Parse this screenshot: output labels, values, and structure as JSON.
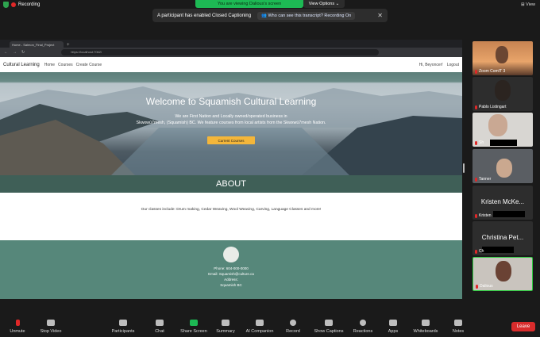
{
  "zoom_top": {
    "recording_label": "Recording",
    "viewing_label": "You are viewing Dalious's screen",
    "view_options_label": "View Options",
    "view_label": "View"
  },
  "caption_notice": {
    "message": "A participant has enabled Closed Captioning",
    "link": "Who can see this transcript? Recording On"
  },
  "browser": {
    "tab_title": "Home - Salmon_Final_Project",
    "url": "https://localhost:7062/"
  },
  "site": {
    "brand": "Cultural Learning",
    "nav": [
      "Home",
      "Courses",
      "Create Course"
    ],
    "greeting": "Hi, Beyoncer!",
    "logout": "Logout",
    "hero_title": "Welcome to Squamish Cultural Learning",
    "hero_line1": "We are First Nation and Locally owned/operated business in",
    "hero_line2": "Skwxwú7mesh, (Squamish) BC. We feature courses from local artists from the Skwxwú7mesh Nation.",
    "hero_button": "Current Courses",
    "about_heading": "ABOUT",
    "about_text": "Our classes include: Drum making, Cedar Weaving, Wool Weaving, Carving, Language Classes and more!",
    "footer_phone": "Phone: 604-000-0000",
    "footer_email": "Email: Squamish@culture.ca",
    "footer_address_label": "Address:",
    "footer_address": "Squamish BC"
  },
  "participants": [
    {
      "name": "Zoom ComIT 3",
      "muted": true
    },
    {
      "name": "Pablo Listingart",
      "muted": true
    },
    {
      "name": "Sh",
      "muted": true
    },
    {
      "name": "Tanner",
      "muted": true
    },
    {
      "name": "Kristen",
      "display": "Kristen McKe...",
      "muted": true
    },
    {
      "name": "Ch",
      "display": "Christina Pet...",
      "muted": true
    },
    {
      "name": "Dalious",
      "muted": true
    }
  ],
  "toolbar": {
    "unmute": "Unmute",
    "stop_video": "Stop Video",
    "participants": "Participants",
    "chat": "Chat",
    "share_screen": "Share Screen",
    "summary": "Summary",
    "ai_companion": "AI Companion",
    "record": "Record",
    "show_captions": "Show Captions",
    "reactions": "Reactions",
    "apps": "Apps",
    "whiteboards": "Whiteboards",
    "notes": "Notes",
    "leave": "Leave"
  },
  "colors": {
    "hero_button": "#f4b63a",
    "about_band": "#3f5f57",
    "footer": "#56877a",
    "leave": "#d92c2c",
    "share_screen": "#1db954"
  }
}
